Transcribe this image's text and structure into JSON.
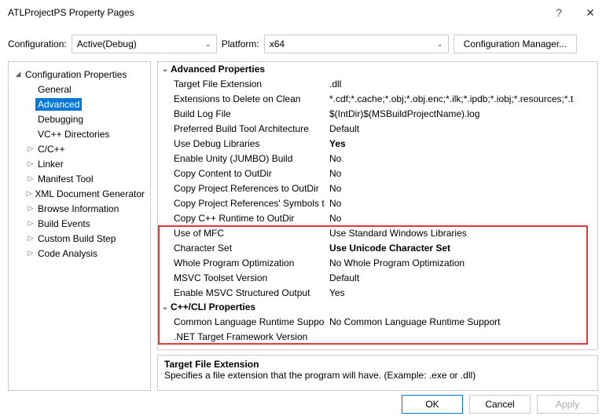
{
  "title": "ATLProjectPS Property Pages",
  "help_glyph": "?",
  "close_glyph": "✕",
  "toprow": {
    "config_label": "Configuration:",
    "config_value": "Active(Debug)",
    "platform_label": "Platform:",
    "platform_value": "x64",
    "cfgmgr_label": "Configuration Manager..."
  },
  "tree": {
    "root": "Configuration Properties",
    "items": [
      {
        "label": "General",
        "expand": ""
      },
      {
        "label": "Advanced",
        "expand": "",
        "selected": true
      },
      {
        "label": "Debugging",
        "expand": ""
      },
      {
        "label": "VC++ Directories",
        "expand": ""
      },
      {
        "label": "C/C++",
        "expand": "▷"
      },
      {
        "label": "Linker",
        "expand": "▷"
      },
      {
        "label": "Manifest Tool",
        "expand": "▷"
      },
      {
        "label": "XML Document Generator",
        "expand": "▷"
      },
      {
        "label": "Browse Information",
        "expand": "▷"
      },
      {
        "label": "Build Events",
        "expand": "▷"
      },
      {
        "label": "Custom Build Step",
        "expand": "▷"
      },
      {
        "label": "Code Analysis",
        "expand": "▷"
      }
    ]
  },
  "grid": {
    "section1": "Advanced Properties",
    "rows1": [
      {
        "name": "Target File Extension",
        "value": ".dll"
      },
      {
        "name": "Extensions to Delete on Clean",
        "value": "*.cdf;*.cache;*.obj;*.obj.enc;*.ilk;*.ipdb;*.iobj;*.resources;*.t"
      },
      {
        "name": "Build Log File",
        "value": "$(IntDir)$(MSBuildProjectName).log"
      },
      {
        "name": "Preferred Build Tool Architecture",
        "value": "Default"
      },
      {
        "name": "Use Debug Libraries",
        "value": "Yes",
        "bold": true
      },
      {
        "name": "Enable Unity (JUMBO) Build",
        "value": "No"
      },
      {
        "name": "Copy Content to OutDir",
        "value": "No"
      },
      {
        "name": "Copy Project References to OutDir",
        "value": "No"
      },
      {
        "name": "Copy Project References' Symbols to OutDir",
        "value": "No"
      },
      {
        "name": "Copy C++ Runtime to OutDir",
        "value": "No"
      },
      {
        "name": "Use of MFC",
        "value": "Use Standard Windows Libraries"
      },
      {
        "name": "Character Set",
        "value": "Use Unicode Character Set",
        "bold": true
      },
      {
        "name": "Whole Program Optimization",
        "value": "No Whole Program Optimization"
      },
      {
        "name": "MSVC Toolset Version",
        "value": "Default"
      },
      {
        "name": "Enable MSVC Structured Output",
        "value": "Yes"
      }
    ],
    "section2": "C++/CLI Properties",
    "rows2": [
      {
        "name": "Common Language Runtime Support",
        "value": "No Common Language Runtime Support"
      },
      {
        "name": ".NET Target Framework Version",
        "value": ""
      }
    ]
  },
  "desc": {
    "title": "Target File Extension",
    "text": "Specifies a file extension that the program will have. (Example: .exe or .dll)"
  },
  "buttons": {
    "ok": "OK",
    "cancel": "Cancel",
    "apply": "Apply"
  }
}
